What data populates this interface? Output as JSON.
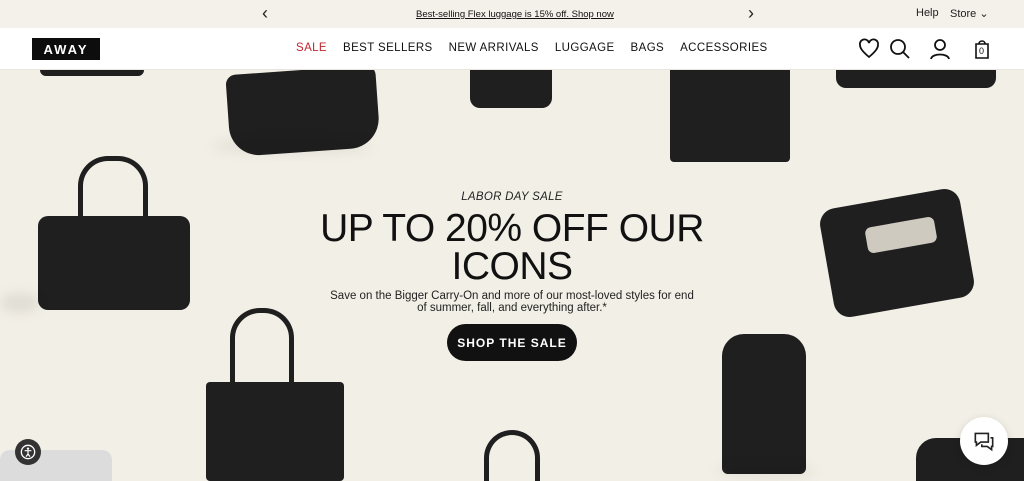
{
  "announcement": {
    "message": "Best-selling Flex luggage is 15% off. Shop now",
    "prev_arrow": "‹",
    "next_arrow": "›"
  },
  "utility": {
    "help": "Help",
    "store": "Store"
  },
  "header": {
    "logo": "AWAY",
    "nav": [
      "SALE",
      "BEST SELLERS",
      "NEW ARRIVALS",
      "LUGGAGE",
      "BAGS",
      "ACCESSORIES"
    ],
    "cart_count": "0",
    "icons": [
      "heart-icon",
      "search-icon",
      "account-icon",
      "cart-icon"
    ]
  },
  "hero": {
    "kicker": "LABOR DAY SALE",
    "headline_line1": "UP TO 20% OFF OUR",
    "headline_line2": "ICONS",
    "sub_line1": "Save on the Bigger Carry-On and more of our most-loved styles for end",
    "sub_line2": "of summer, fall, and everything after.*",
    "cta": "SHOP THE SALE"
  },
  "colors": {
    "sale_red": "#c4252e",
    "hero_bg": "#f2efe6",
    "bag": "#1f1f1f"
  }
}
